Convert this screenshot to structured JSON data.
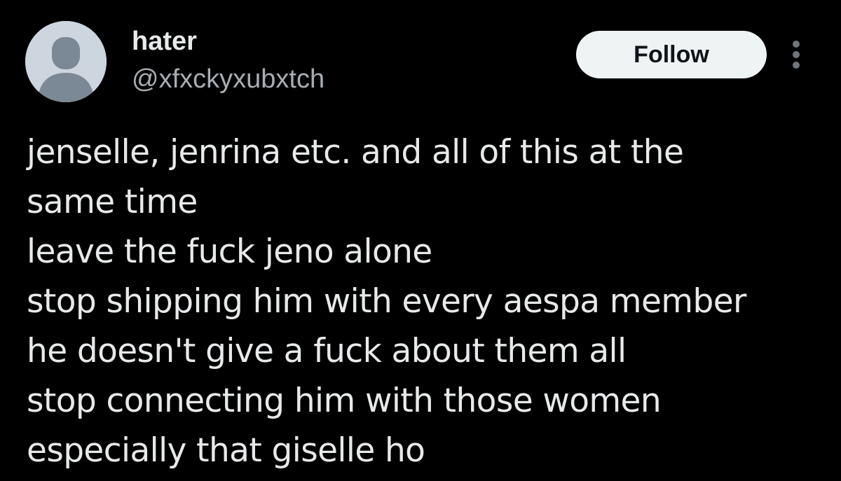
{
  "author": {
    "display_name": "hater",
    "handle": "@xfxckyxubxtch",
    "avatar_icon": "default-profile-silhouette-icon"
  },
  "actions": {
    "follow_label": "Follow",
    "more_icon": "more-options-icon"
  },
  "tweet": {
    "lines": [
      "jenselle, jenrina etc. and all of this at the",
      "same time",
      "leave the fuck jeno alone",
      "stop shipping him with every aespa member",
      "he doesn't give a fuck about them all",
      "stop connecting him with those women",
      "especially that giselle ho"
    ]
  },
  "colors": {
    "background": "#000000",
    "primary_text": "#e7e9ea",
    "secondary_text": "#a7adb3",
    "follow_button_bg": "#eff3f4",
    "avatar_bg": "#cdd6de",
    "avatar_figure": "#7b8895"
  }
}
